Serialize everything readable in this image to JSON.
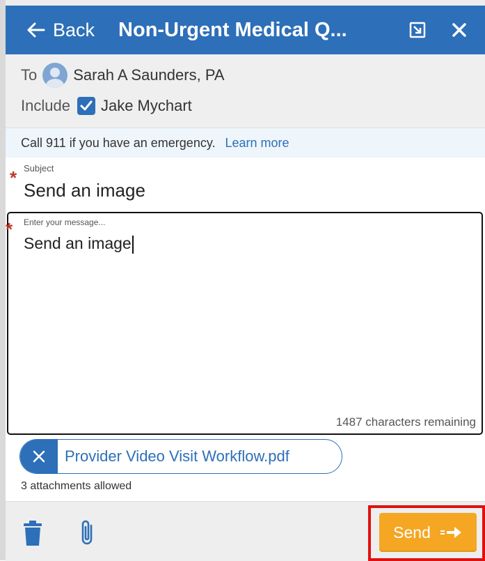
{
  "header": {
    "back_label": "Back",
    "title": "Non-Urgent Medical Q..."
  },
  "recipients": {
    "to_label": "To",
    "to_name": "Sarah A Saunders, PA",
    "include_label": "Include",
    "include_name": "Jake Mychart",
    "include_checked": true
  },
  "notice": {
    "text": "Call 911 if you have an emergency.",
    "link": "Learn more"
  },
  "subject": {
    "label": "Subject",
    "value": "Send an image"
  },
  "message": {
    "placeholder": "Enter your message...",
    "value": "Send an image",
    "remaining": "1487 characters remaining"
  },
  "attachment": {
    "filename": "Provider Video Visit Workflow.pdf",
    "allowed": "3 attachments allowed"
  },
  "footer": {
    "send_label": "Send"
  },
  "colors": {
    "header": "#2d6fb8",
    "accent": "#2d6fb8",
    "send": "#f5a623",
    "required": "#c0392b",
    "highlight": "#e01010"
  }
}
